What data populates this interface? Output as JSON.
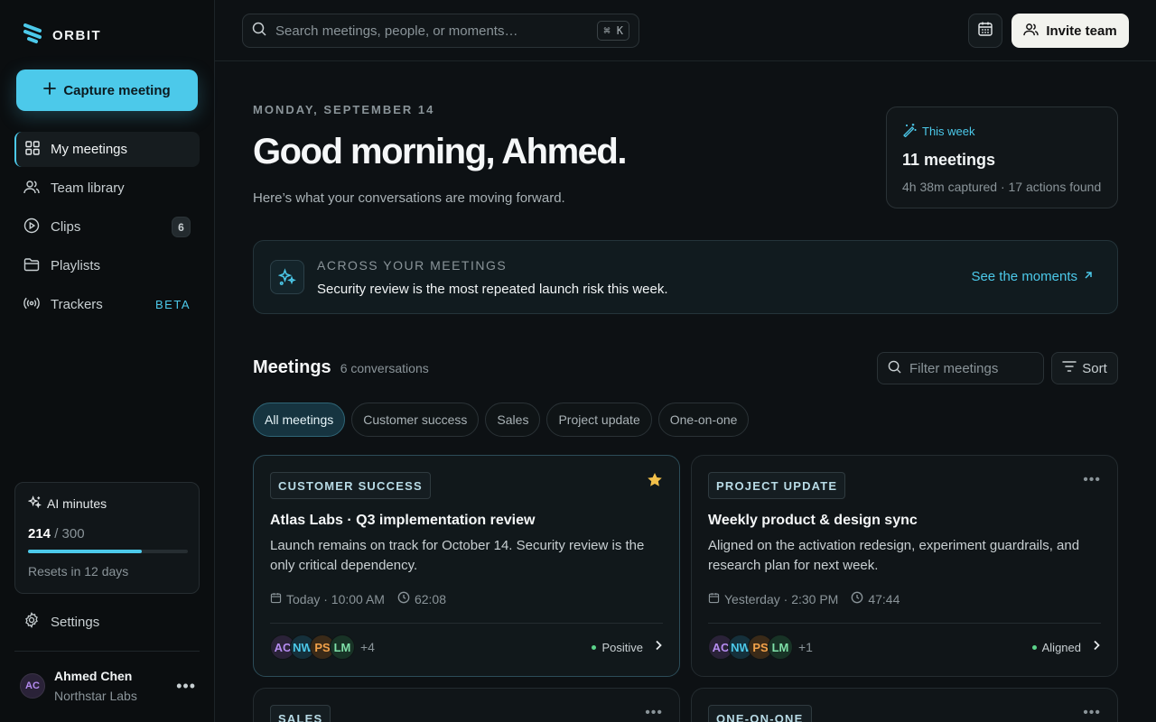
{
  "brand": {
    "name": "ORBIT"
  },
  "sidebar": {
    "capture_label": "Capture meeting",
    "items": [
      {
        "label": "My meetings",
        "icon": "grid-icon",
        "active": true
      },
      {
        "label": "Team library",
        "icon": "users-icon"
      },
      {
        "label": "Clips",
        "icon": "play-circle-icon",
        "badge": "6"
      },
      {
        "label": "Playlists",
        "icon": "folder-icon"
      },
      {
        "label": "Trackers",
        "icon": "radar-icon",
        "tag": "BETA"
      }
    ],
    "ai_card": {
      "title": "AI minutes",
      "used": "214",
      "limit": "/ 300",
      "used_fraction": 0.713,
      "reset": "Resets in 12 days"
    },
    "settings_label": "Settings",
    "user": {
      "initials": "AC",
      "name": "Ahmed Chen",
      "org": "Northstar Labs"
    }
  },
  "topbar": {
    "search_placeholder": "Search meetings, people, or moments…",
    "shortcut": "⌘ K",
    "invite_label": "Invite team"
  },
  "hero": {
    "date": "MONDAY, SEPTEMBER 14",
    "greeting": "Good morning, Ahmed.",
    "subtitle": "Here’s what your conversations are moving forward."
  },
  "week": {
    "label": "This week",
    "count": "11 meetings",
    "summary": "4h 38m captured · 17 actions found"
  },
  "insight": {
    "kicker": "ACROSS YOUR MEETINGS",
    "text": "Security review is the most repeated launch risk this week.",
    "link": "See the moments"
  },
  "meetings": {
    "title": "Meetings",
    "count": "6 conversations",
    "filter_placeholder": "Filter meetings",
    "sort_label": "Sort",
    "chips": [
      "All meetings",
      "Customer success",
      "Sales",
      "Project update",
      "One-on-one"
    ],
    "cards": [
      {
        "tag": "CUSTOMER SUCCESS",
        "title": "Atlas Labs · Q3 implementation review",
        "desc": "Launch remains on track for October 14. Security review is the only critical dependency.",
        "date": "Today · 10:00 AM",
        "duration": "62:08",
        "avatars": [
          "AC",
          "NW",
          "PS",
          "LM"
        ],
        "more": "+4",
        "status": "Positive",
        "starred": true
      },
      {
        "tag": "PROJECT UPDATE",
        "title": "Weekly product & design sync",
        "desc": "Aligned on the activation redesign, experiment guardrails, and research plan for next week.",
        "date": "Yesterday · 2:30 PM",
        "duration": "47:44",
        "avatars": [
          "AC",
          "NW",
          "PS",
          "LM"
        ],
        "more": "+1",
        "status": "Aligned",
        "starred": false
      },
      {
        "tag": "SALES"
      },
      {
        "tag": "ONE-ON-ONE"
      }
    ]
  },
  "colors": {
    "accent": "#4cc9ea",
    "background": "#0d1114",
    "positive": "#5bd38a",
    "star": "#f2c04a"
  }
}
